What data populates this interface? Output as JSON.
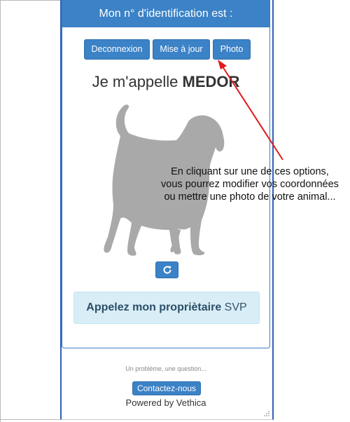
{
  "header": {
    "title": "Mon n° d'identification est :"
  },
  "actions": {
    "logout": "Deconnexion",
    "update": "Mise à jour",
    "photo": "Photo"
  },
  "pet": {
    "intro": "Je m'appelle",
    "name": "MEDOR"
  },
  "alert": {
    "bold": "Appelez mon propriètaire",
    "rest": "SVP"
  },
  "footer": {
    "note": "Un problème, une question...",
    "contact": "Contactez-nous",
    "powered": "Powered by Vethica"
  },
  "annotation": {
    "lines": [
      "En cliquant sur une de ces options,",
      "vous pourrez modifier vos coordonnées",
      "ou mettre une photo de votre animal..."
    ]
  },
  "colors": {
    "primary": "#3b82c7",
    "alert_bg": "#d9edf7",
    "arrow": "#e01b1b",
    "dog": "#a9a9a9"
  },
  "icons": {
    "refresh": "refresh-icon",
    "dog": "dog-silhouette",
    "grip": "resize-grip-icon"
  }
}
